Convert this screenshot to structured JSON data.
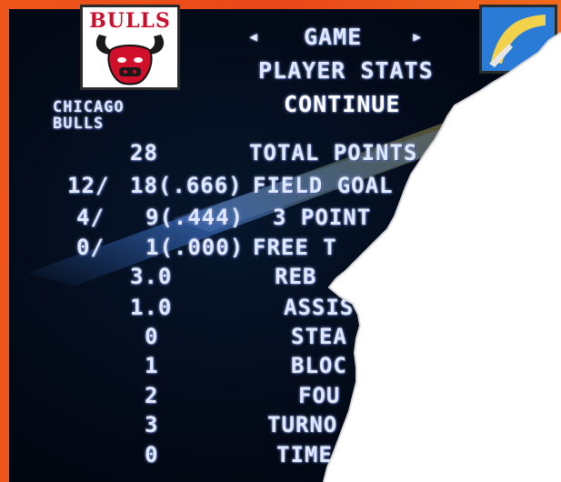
{
  "menu": {
    "left_arrow": "◂",
    "mode": "GAME",
    "right_arrow": "▸",
    "screen_title": "PLAYER STATS",
    "continue_label": "CONTINUE"
  },
  "team": {
    "name_line1": "CHICAGO",
    "name_line2": "BULLS",
    "logo_text": "BULLS",
    "logo_icon": "bull-head-icon"
  },
  "stats": [
    {
      "made": "",
      "value": "28",
      "label": "TOTAL POINTS"
    },
    {
      "made": "12/",
      "value": "18(.666)",
      "label": "FIELD GOAL"
    },
    {
      "made": "4/",
      "value": "9(.444)",
      "label": "3 POINT"
    },
    {
      "made": "0/",
      "value": "1(.000)",
      "label": "FREE T"
    },
    {
      "made": "",
      "value": "3.0",
      "label": "REB"
    },
    {
      "made": "",
      "value": "1.0",
      "label": "ASSIS"
    },
    {
      "made": "",
      "value": "0",
      "label": "STEA"
    },
    {
      "made": "",
      "value": "1",
      "label": "BLOC"
    },
    {
      "made": "",
      "value": "2",
      "label": "FOU"
    },
    {
      "made": "",
      "value": "3",
      "label": "TURNO"
    },
    {
      "made": "",
      "value": "0",
      "label": "TIME"
    }
  ],
  "colors": {
    "frame": "#e8471a",
    "screen": "#030a18",
    "text": "#dfe8ff",
    "logo_red": "#c8102e"
  }
}
